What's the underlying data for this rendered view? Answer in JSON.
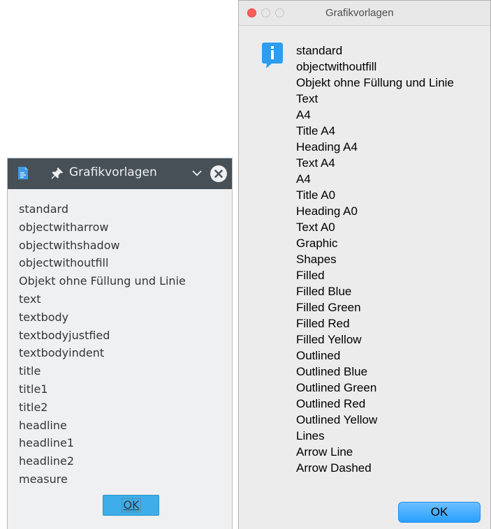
{
  "left_dialog": {
    "title": "Grafikvorlagen",
    "items": [
      "standard",
      "objectwitharrow",
      "objectwithshadow",
      "objectwithoutfill",
      "Objekt ohne Füllung und Linie",
      "text",
      "textbody",
      "textbodyjustfied",
      "textbodyindent",
      "title",
      "title1",
      "title2",
      "headline",
      "headline1",
      "headline2",
      "measure"
    ],
    "ok_label": "OK",
    "icons": {
      "app": "document-app-icon",
      "pin": "pin-icon",
      "menu": "chevron-down-icon",
      "close": "close-icon"
    },
    "colors": {
      "titlebar": "#475057",
      "background": "#eff0f1",
      "ok_button": "#3daee9"
    }
  },
  "right_dialog": {
    "title": "Grafikvorlagen",
    "items": [
      "standard",
      "objectwithoutfill",
      "Objekt ohne Füllung und Linie",
      "Text",
      "A4",
      "Title A4",
      "Heading A4",
      "Text A4",
      "A4",
      "Title A0",
      "Heading A0",
      "Text A0",
      "Graphic",
      "Shapes",
      "Filled",
      "Filled Blue",
      "Filled Green",
      "Filled Red",
      "Filled Yellow",
      "Outlined",
      "Outlined Blue",
      "Outlined Green",
      "Outlined Red",
      "Outlined Yellow",
      "Lines",
      "Arrow Line",
      "Arrow Dashed"
    ],
    "ok_label": "OK",
    "icons": {
      "info": "info-icon",
      "close": "close-light-icon",
      "minimize": "minimize-light-icon",
      "zoom": "zoom-light-icon"
    },
    "colors": {
      "background": "#ececec",
      "close_light": "#fc5f57",
      "info_icon": "#2c9df0",
      "ok_button": "#27a0ff"
    }
  }
}
